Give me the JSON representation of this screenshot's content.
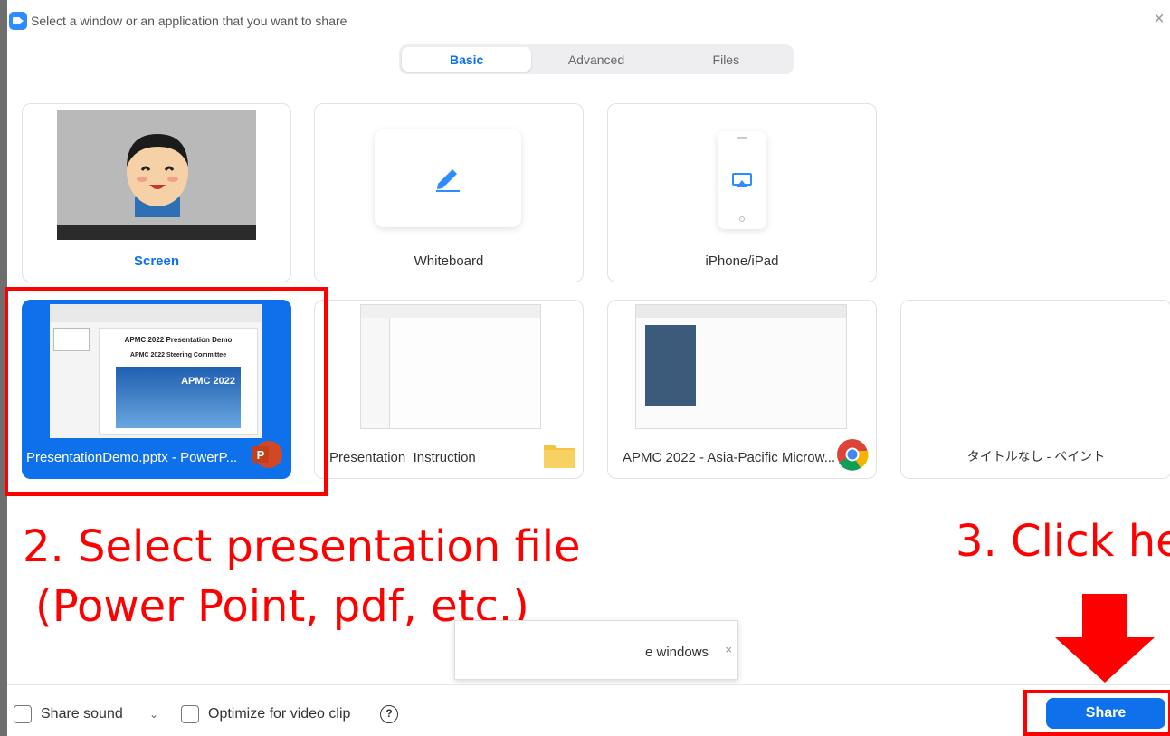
{
  "colors": {
    "accent": "#0e71eb",
    "annotation": "#ff0000",
    "powerpoint": "#d24726",
    "folder": "#f4c542"
  },
  "window": {
    "title": "Select a window or an application that you want to share",
    "app_icon": "zoom-video-icon",
    "close_icon": "close-icon"
  },
  "tabs": [
    {
      "label": "Basic",
      "active": true
    },
    {
      "label": "Advanced",
      "active": false
    },
    {
      "label": "Files",
      "active": false
    }
  ],
  "tiles_row1": [
    {
      "label": "Screen",
      "icon": "desktop-preview"
    },
    {
      "label": "Whiteboard",
      "icon": "pencil-icon"
    },
    {
      "label": "iPhone/iPad",
      "icon": "airplay-icon"
    }
  ],
  "tiles_row2": [
    {
      "label": "PresentationDemo.pptx - PowerP...",
      "icon": "powerpoint-icon",
      "selected": true
    },
    {
      "label": "Presentation_Instruction",
      "icon": "folder-icon",
      "selected": false
    },
    {
      "label": "APMC 2022 - Asia-Pacific Microw...",
      "icon": "chrome-icon",
      "selected": false
    },
    {
      "label": "タイトルなし - ペイント",
      "icon": "paint-app",
      "selected": false
    }
  ],
  "thumbnails": {
    "ppt_title": "APMC 2022 Presentation Demo",
    "ppt_subtitle": "APMC 2022 Steering Committee",
    "ppt_logo": "APMC 2022"
  },
  "annotations": {
    "step2_line1": "2. Select presentation file",
    "step2_line2": "(Power Point, pdf, etc.)",
    "step3": "3. Click he"
  },
  "toast": {
    "text": "e windows",
    "close": "×"
  },
  "footer": {
    "share_sound_label": "Share sound",
    "optimize_label": "Optimize for video clip",
    "help": "?",
    "share_button": "Share"
  }
}
